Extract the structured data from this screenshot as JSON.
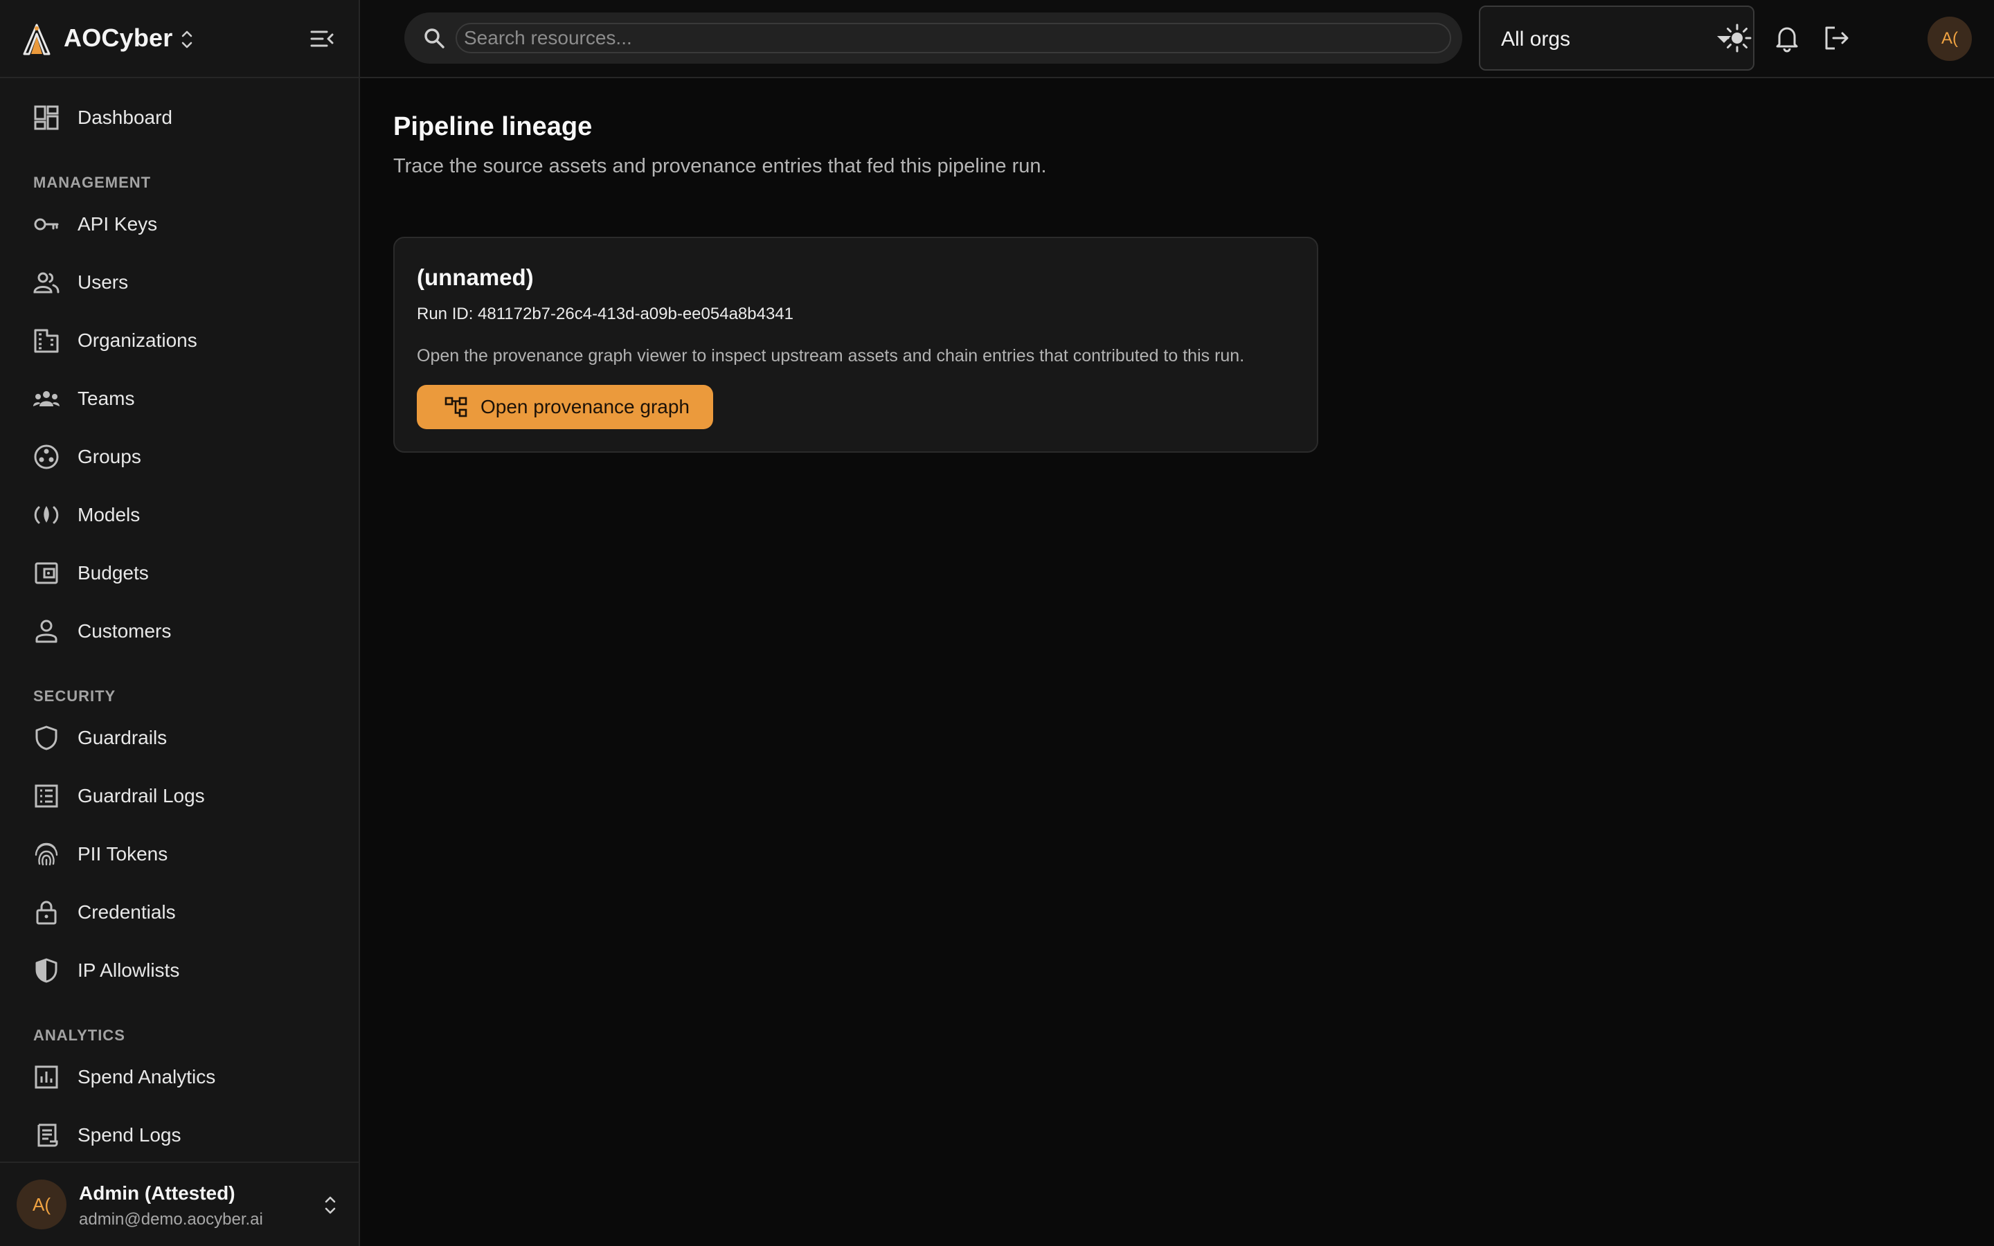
{
  "app": {
    "name": "AOCyber"
  },
  "sidebar": {
    "dashboard": "Dashboard",
    "sections": {
      "management": "MANAGEMENT",
      "security": "SECURITY",
      "analytics": "ANALYTICS"
    },
    "management_items": [
      "API Keys",
      "Users",
      "Organizations",
      "Teams",
      "Groups",
      "Models",
      "Budgets",
      "Customers"
    ],
    "security_items": [
      "Guardrails",
      "Guardrail Logs",
      "PII Tokens",
      "Credentials",
      "IP Allowlists"
    ],
    "analytics_items": [
      "Spend Analytics",
      "Spend Logs"
    ],
    "user": {
      "initials": "A(",
      "name": "Admin (Attested)",
      "email": "admin@demo.aocyber.ai"
    }
  },
  "topbar": {
    "search_placeholder": "Search resources...",
    "org_select": "All orgs",
    "avatar_initials": "A("
  },
  "main": {
    "title": "Pipeline lineage",
    "subtitle": "Trace the source assets and provenance entries that fed this pipeline run.",
    "card": {
      "title": "(unnamed)",
      "run_id": "Run ID: 481172b7-26c4-413d-a09b-ee054a8b4341",
      "description": "Open the provenance graph viewer to inspect upstream assets and chain entries that contributed to this run.",
      "button_label": "Open provenance graph"
    }
  },
  "colors": {
    "accent": "#eb9a3c",
    "background": "#0a0a0a",
    "sidebar": "#161616"
  }
}
